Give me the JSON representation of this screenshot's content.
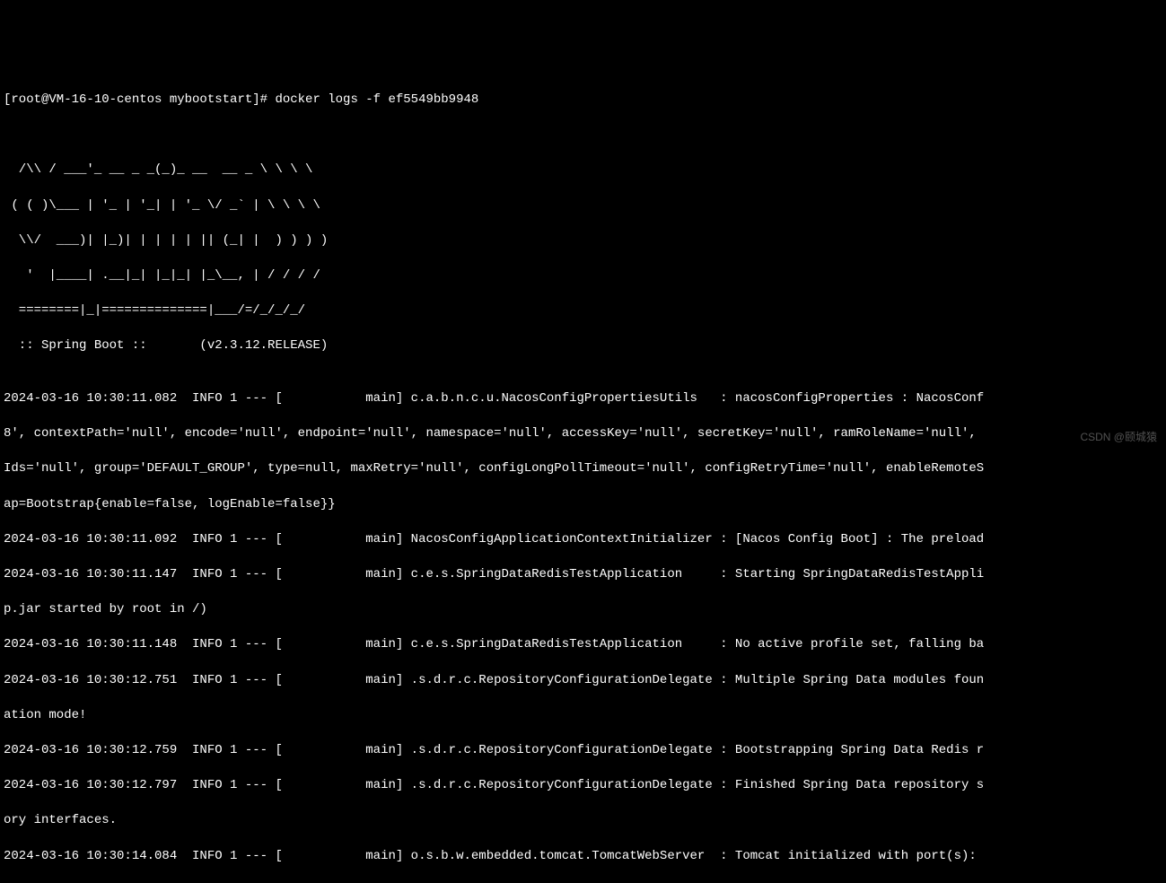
{
  "prompt": "[root@VM-16-10-centos mybootstart]# docker logs -f ef5549bb9948",
  "blank1": "",
  "blank2": "",
  "banner1": "  /\\\\ / ___'_ __ _ _(_)_ __  __ _ \\ \\ \\ \\",
  "banner2": " ( ( )\\___ | '_ | '_| | '_ \\/ _` | \\ \\ \\ \\",
  "banner3": "  \\\\/  ___)| |_)| | | | | || (_| |  ) ) ) )",
  "banner4": "   '  |____| .__|_| |_|_| |_\\__, | / / / /",
  "banner5": "  ========|_|==============|___/=/_/_/_/",
  "banner6": "  :: Spring Boot ::       (v2.3.12.RELEASE)",
  "blank3": "",
  "log1": "2024-03-16 10:30:11.082  INFO 1 --- [           main] c.a.b.n.c.u.NacosConfigPropertiesUtils   : nacosConfigProperties : NacosConf",
  "log2": "8', contextPath='null', encode='null', endpoint='null', namespace='null', accessKey='null', secretKey='null', ramRoleName='null', ",
  "log3": "Ids='null', group='DEFAULT_GROUP', type=null, maxRetry='null', configLongPollTimeout='null', configRetryTime='null', enableRemoteS",
  "log4": "ap=Bootstrap{enable=false, logEnable=false}}",
  "log5": "2024-03-16 10:30:11.092  INFO 1 --- [           main] NacosConfigApplicationContextInitializer : [Nacos Config Boot] : The preload",
  "log6": "2024-03-16 10:30:11.147  INFO 1 --- [           main] c.e.s.SpringDataRedisTestApplication     : Starting SpringDataRedisTestAppli",
  "log7": "p.jar started by root in /)",
  "log8": "2024-03-16 10:30:11.148  INFO 1 --- [           main] c.e.s.SpringDataRedisTestApplication     : No active profile set, falling ba",
  "log9": "2024-03-16 10:30:12.751  INFO 1 --- [           main] .s.d.r.c.RepositoryConfigurationDelegate : Multiple Spring Data modules foun",
  "log10": "ation mode!",
  "log11": "2024-03-16 10:30:12.759  INFO 1 --- [           main] .s.d.r.c.RepositoryConfigurationDelegate : Bootstrapping Spring Data Redis r",
  "log12": "2024-03-16 10:30:12.797  INFO 1 --- [           main] .s.d.r.c.RepositoryConfigurationDelegate : Finished Spring Data repository s",
  "log13": "ory interfaces.",
  "log14": "2024-03-16 10:30:14.084  INFO 1 --- [           main] o.s.b.w.embedded.tomcat.TomcatWebServer  : Tomcat initialized with port(s): ",
  "watermark": "CSDN @颐城猿"
}
